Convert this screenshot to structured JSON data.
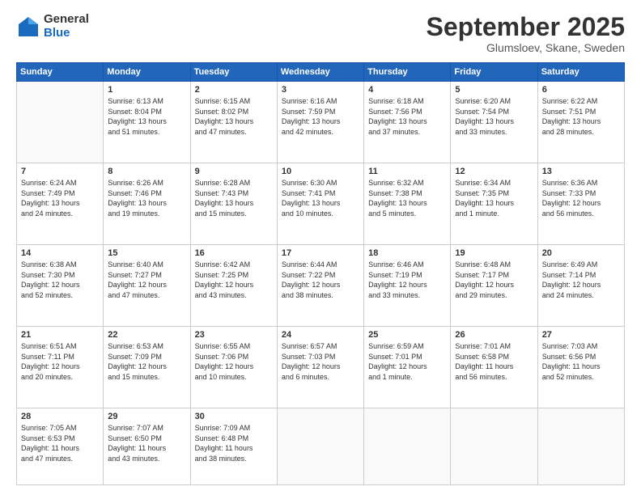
{
  "logo": {
    "general": "General",
    "blue": "Blue"
  },
  "title": "September 2025",
  "location": "Glumsloev, Skane, Sweden",
  "days_of_week": [
    "Sunday",
    "Monday",
    "Tuesday",
    "Wednesday",
    "Thursday",
    "Friday",
    "Saturday"
  ],
  "weeks": [
    [
      {
        "day": "",
        "info": ""
      },
      {
        "day": "1",
        "info": "Sunrise: 6:13 AM\nSunset: 8:04 PM\nDaylight: 13 hours\nand 51 minutes."
      },
      {
        "day": "2",
        "info": "Sunrise: 6:15 AM\nSunset: 8:02 PM\nDaylight: 13 hours\nand 47 minutes."
      },
      {
        "day": "3",
        "info": "Sunrise: 6:16 AM\nSunset: 7:59 PM\nDaylight: 13 hours\nand 42 minutes."
      },
      {
        "day": "4",
        "info": "Sunrise: 6:18 AM\nSunset: 7:56 PM\nDaylight: 13 hours\nand 37 minutes."
      },
      {
        "day": "5",
        "info": "Sunrise: 6:20 AM\nSunset: 7:54 PM\nDaylight: 13 hours\nand 33 minutes."
      },
      {
        "day": "6",
        "info": "Sunrise: 6:22 AM\nSunset: 7:51 PM\nDaylight: 13 hours\nand 28 minutes."
      }
    ],
    [
      {
        "day": "7",
        "info": "Sunrise: 6:24 AM\nSunset: 7:49 PM\nDaylight: 13 hours\nand 24 minutes."
      },
      {
        "day": "8",
        "info": "Sunrise: 6:26 AM\nSunset: 7:46 PM\nDaylight: 13 hours\nand 19 minutes."
      },
      {
        "day": "9",
        "info": "Sunrise: 6:28 AM\nSunset: 7:43 PM\nDaylight: 13 hours\nand 15 minutes."
      },
      {
        "day": "10",
        "info": "Sunrise: 6:30 AM\nSunset: 7:41 PM\nDaylight: 13 hours\nand 10 minutes."
      },
      {
        "day": "11",
        "info": "Sunrise: 6:32 AM\nSunset: 7:38 PM\nDaylight: 13 hours\nand 5 minutes."
      },
      {
        "day": "12",
        "info": "Sunrise: 6:34 AM\nSunset: 7:35 PM\nDaylight: 13 hours\nand 1 minute."
      },
      {
        "day": "13",
        "info": "Sunrise: 6:36 AM\nSunset: 7:33 PM\nDaylight: 12 hours\nand 56 minutes."
      }
    ],
    [
      {
        "day": "14",
        "info": "Sunrise: 6:38 AM\nSunset: 7:30 PM\nDaylight: 12 hours\nand 52 minutes."
      },
      {
        "day": "15",
        "info": "Sunrise: 6:40 AM\nSunset: 7:27 PM\nDaylight: 12 hours\nand 47 minutes."
      },
      {
        "day": "16",
        "info": "Sunrise: 6:42 AM\nSunset: 7:25 PM\nDaylight: 12 hours\nand 43 minutes."
      },
      {
        "day": "17",
        "info": "Sunrise: 6:44 AM\nSunset: 7:22 PM\nDaylight: 12 hours\nand 38 minutes."
      },
      {
        "day": "18",
        "info": "Sunrise: 6:46 AM\nSunset: 7:19 PM\nDaylight: 12 hours\nand 33 minutes."
      },
      {
        "day": "19",
        "info": "Sunrise: 6:48 AM\nSunset: 7:17 PM\nDaylight: 12 hours\nand 29 minutes."
      },
      {
        "day": "20",
        "info": "Sunrise: 6:49 AM\nSunset: 7:14 PM\nDaylight: 12 hours\nand 24 minutes."
      }
    ],
    [
      {
        "day": "21",
        "info": "Sunrise: 6:51 AM\nSunset: 7:11 PM\nDaylight: 12 hours\nand 20 minutes."
      },
      {
        "day": "22",
        "info": "Sunrise: 6:53 AM\nSunset: 7:09 PM\nDaylight: 12 hours\nand 15 minutes."
      },
      {
        "day": "23",
        "info": "Sunrise: 6:55 AM\nSunset: 7:06 PM\nDaylight: 12 hours\nand 10 minutes."
      },
      {
        "day": "24",
        "info": "Sunrise: 6:57 AM\nSunset: 7:03 PM\nDaylight: 12 hours\nand 6 minutes."
      },
      {
        "day": "25",
        "info": "Sunrise: 6:59 AM\nSunset: 7:01 PM\nDaylight: 12 hours\nand 1 minute."
      },
      {
        "day": "26",
        "info": "Sunrise: 7:01 AM\nSunset: 6:58 PM\nDaylight: 11 hours\nand 56 minutes."
      },
      {
        "day": "27",
        "info": "Sunrise: 7:03 AM\nSunset: 6:56 PM\nDaylight: 11 hours\nand 52 minutes."
      }
    ],
    [
      {
        "day": "28",
        "info": "Sunrise: 7:05 AM\nSunset: 6:53 PM\nDaylight: 11 hours\nand 47 minutes."
      },
      {
        "day": "29",
        "info": "Sunrise: 7:07 AM\nSunset: 6:50 PM\nDaylight: 11 hours\nand 43 minutes."
      },
      {
        "day": "30",
        "info": "Sunrise: 7:09 AM\nSunset: 6:48 PM\nDaylight: 11 hours\nand 38 minutes."
      },
      {
        "day": "",
        "info": ""
      },
      {
        "day": "",
        "info": ""
      },
      {
        "day": "",
        "info": ""
      },
      {
        "day": "",
        "info": ""
      }
    ]
  ]
}
